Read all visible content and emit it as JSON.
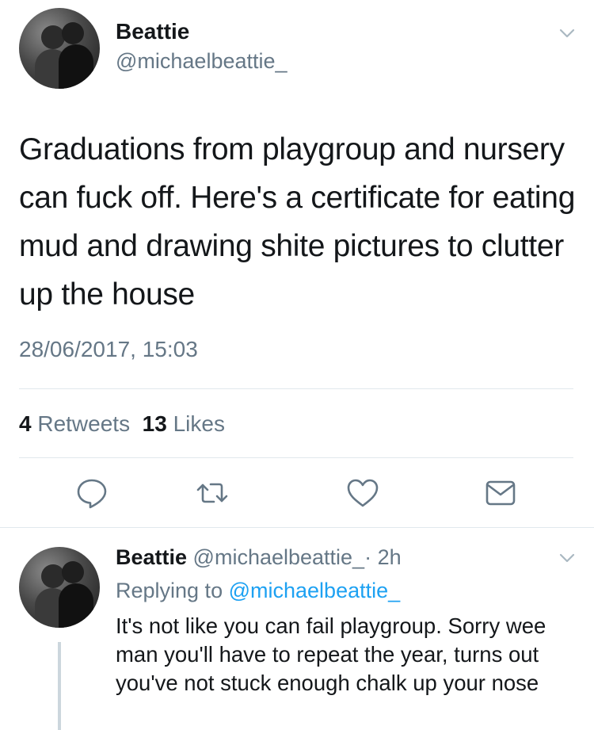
{
  "tweet": {
    "author_name": "Beattie",
    "author_handle": "@michaelbeattie_",
    "text": "Graduations from playgroup and nursery can fuck off. Here's a certificate for eating mud and drawing shite pictures to clutter up the house",
    "timestamp": "28/06/2017, 15:03",
    "retweets_count": "4",
    "retweets_label": "Retweets",
    "likes_count": "13",
    "likes_label": "Likes"
  },
  "actions": {
    "reply_icon": "speech-bubble",
    "retweet_icon": "retweet-arrows",
    "like_icon": "heart",
    "dm_icon": "envelope"
  },
  "reply": {
    "author_name": "Beattie",
    "author_handle": "@michaelbeattie_",
    "separator": "·",
    "time_ago": "2h",
    "replying_prefix": "Replying to",
    "replying_to": "@michaelbeattie_",
    "text": "It's not like you can fail playgroup. Sorry wee man you'll have to repeat the year, turns out you've not stuck enough chalk up your nose"
  },
  "colors": {
    "text": "#14171a",
    "secondary": "#657786",
    "link": "#1da1f2",
    "divider": "#e1e8ed"
  }
}
